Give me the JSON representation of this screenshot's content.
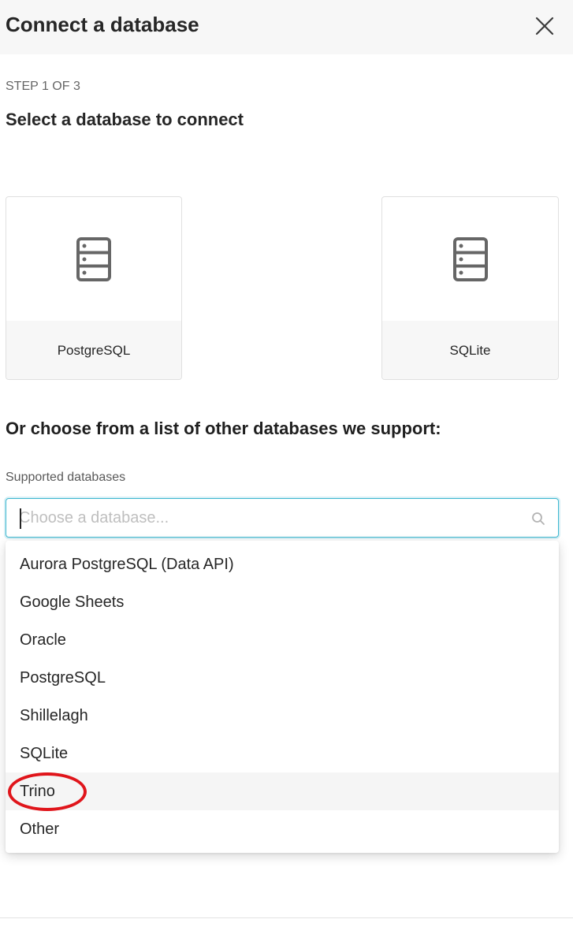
{
  "modal": {
    "title": "Connect a database",
    "step": "STEP 1 OF 3",
    "subtitle": "Select a database to connect"
  },
  "preferred": [
    {
      "label": "PostgreSQL",
      "icon": "database-icon"
    },
    {
      "label": "SQLite",
      "icon": "database-icon"
    }
  ],
  "other": {
    "heading": "Or choose from a list of other databases we support:",
    "field_label": "Supported databases",
    "placeholder": "Choose a database...",
    "value": "",
    "options": [
      "Aurora PostgreSQL (Data API)",
      "Google Sheets",
      "Oracle",
      "PostgreSQL",
      "Shillelagh",
      "SQLite",
      "Trino",
      "Other"
    ],
    "highlighted_option": "Trino"
  },
  "annotation": {
    "target": "Trino",
    "color": "#e0151b"
  },
  "colors": {
    "focus_border": "#3fb8d0",
    "header_bg": "#f7f7f7"
  }
}
